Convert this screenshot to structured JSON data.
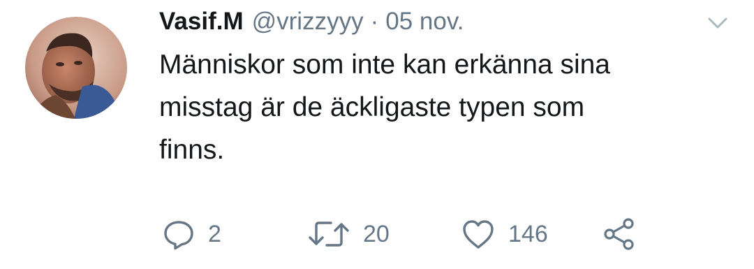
{
  "tweet": {
    "author_name": "Vasif.M",
    "handle": "@vrizzyyy",
    "separator": "·",
    "date": "05 nov.",
    "text": "Människor som inte kan erkänna sina\nmisstag är de äckligaste typen som\nfinns."
  },
  "actions": {
    "reply_count": "2",
    "retweet_count": "20",
    "like_count": "146",
    "icons": [
      "reply-icon",
      "retweet-icon",
      "like-icon",
      "share-icon"
    ]
  },
  "menu": {
    "icon": "chevron-down-icon"
  },
  "colors": {
    "text": "#14171a",
    "secondary": "#657786",
    "icon": "#657786",
    "background": "#ffffff"
  }
}
